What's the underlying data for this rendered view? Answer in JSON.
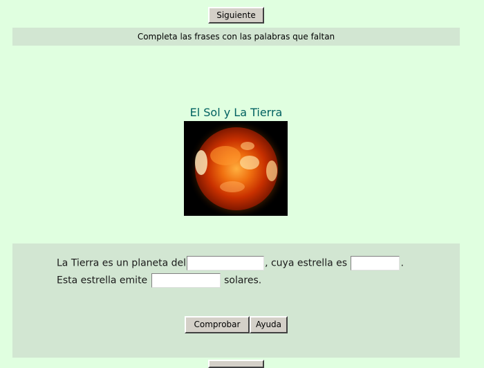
{
  "nav": {
    "next_label": "Siguiente"
  },
  "instructions": {
    "text": "Completa las frases con las palabras que faltan"
  },
  "exercise": {
    "title": "El Sol y La Tierra",
    "image_icon": "sun-photo",
    "sentence1": {
      "part1": "La Tierra es un planeta del",
      "gap1_value": "",
      "part2": ", cuya estrella es",
      "gap2_value": "",
      "part3": "."
    },
    "sentence2": {
      "part1": "Esta estrella emite",
      "gap3_value": "",
      "part2": "solares."
    }
  },
  "actions": {
    "check_label": "Comprobar",
    "help_label": "Ayuda"
  },
  "colors": {
    "page_background": "#e0ffe0",
    "band_background": "#d2e6d2",
    "title_color": "#006060"
  }
}
